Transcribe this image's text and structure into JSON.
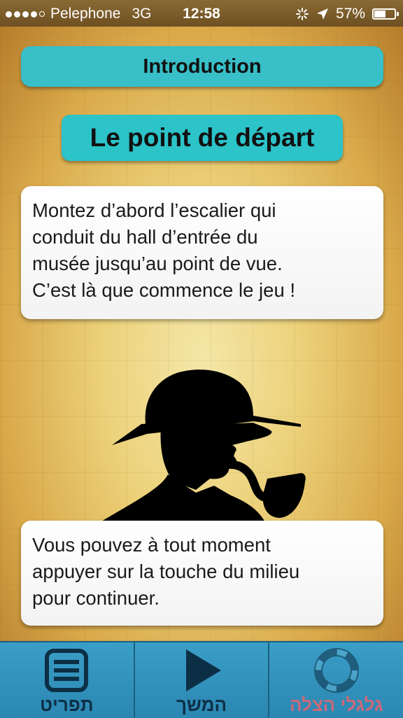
{
  "status_bar": {
    "carrier": "Pelephone",
    "network": "3G",
    "time": "12:58",
    "battery_percent": "57%",
    "battery_level": 0.57
  },
  "header": {
    "section": "Introduction",
    "title": "Le point de départ"
  },
  "cards": {
    "intro_text": [
      "Montez d’abord l’escalier qui",
      "conduit du hall d’entrée du",
      "musée jusqu’au point de vue.",
      "C’est là que commence le jeu !"
    ],
    "hint_text": [
      "Vous pouvez à tout moment",
      "appuyer sur la touche du milieu",
      "pour continuer."
    ]
  },
  "toolbar": {
    "menu_label": "תפריט",
    "continue_label": "המשך",
    "lifebuoy_label": "גלגלי הצלה"
  },
  "colors": {
    "accent": "#2cc3c9",
    "toolbar": "#3a9ec7",
    "disabled_label": "#c96a7a"
  },
  "icons": {
    "menu": "menu-list-icon",
    "continue": "play-icon",
    "lifebuoy": "lifebuoy-icon",
    "location": "location-arrow-icon",
    "activity": "activity-spinner-icon"
  }
}
